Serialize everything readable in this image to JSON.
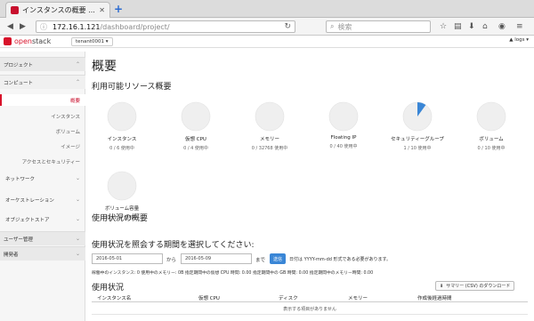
{
  "browser": {
    "tab_title": "インスタンスの概要 ...",
    "url_host": "172.16.1.121",
    "url_path": "/dashboard/project/",
    "search_placeholder": "検索"
  },
  "header": {
    "logo_text_1": "open",
    "logo_text_2": "stack",
    "project": "tenant0001 ▾",
    "user": "▲ logs ▾"
  },
  "sidebar": {
    "project": "プロジェクト",
    "compute": "コンピュート",
    "overview": "概要",
    "instances": "インスタンス",
    "volumes": "ボリューム",
    "images": "イメージ",
    "access": "アクセスとセキュリティー",
    "network": "ネットワーク",
    "orchestration": "オーケストレーション",
    "object_store": "オブジェクトストア",
    "user_mgmt": "ユーザー管理",
    "developer": "開発者"
  },
  "main": {
    "title": "概要",
    "limits_heading": "利用可能リソース概要",
    "usage_overview_heading": "使用状況の概要",
    "period_heading": "使用状況を照会する期間を選択してください:",
    "date_from": "2016-05-01",
    "from_suffix": "から",
    "date_to": "2016-05-09",
    "to_suffix": "まで",
    "submit": "送信",
    "date_hint": "日付は YYYY-mm-dd 形式である必要があります。",
    "summary_line": "稼働中のインスタンス: 0 使用中のメモリー: 0B 指定期間中の仮想 CPU 時間: 0.00 指定期間中の GB 時間: 0.00 指定期間中のメモリー時間: 0.00",
    "usage_heading": "使用状況",
    "csv_button": "サマリー (CSV) のダウンロード",
    "columns": [
      "インスタンス名",
      "仮想 CPU",
      "ディスク",
      "メモリー",
      "作成後経過時間"
    ],
    "empty": "表示する項目がありません"
  },
  "limits": [
    {
      "label": "インスタンス",
      "usage": "0 / 6 使用中",
      "fraction": 0.0
    },
    {
      "label": "仮想 CPU",
      "usage": "0 / 4 使用中",
      "fraction": 0.0
    },
    {
      "label": "メモリー",
      "usage": "0 / 32768 使用中",
      "fraction": 0.0
    },
    {
      "label": "Floating IP",
      "usage": "0 / 40 使用中",
      "fraction": 0.0
    },
    {
      "label": "セキュリティーグループ",
      "usage": "1 / 10 使用中",
      "fraction": 0.1
    },
    {
      "label": "ボリューム",
      "usage": "0 / 10 使用中",
      "fraction": 0.0
    },
    {
      "label": "ボリューム容量",
      "usage": "0 / 100 使用中",
      "fraction": 0.0
    }
  ],
  "colors": {
    "accent": "#d8122a",
    "pie_used": "#3a86d6",
    "pie_free": "#efefef"
  }
}
